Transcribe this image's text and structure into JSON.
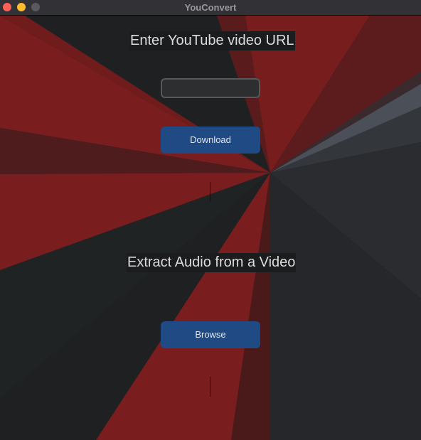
{
  "window": {
    "title": "YouConvert",
    "controls": {
      "close": "#fe5f57",
      "minimize": "#febc2e",
      "zoom": "#5a5a5e"
    }
  },
  "download_section": {
    "heading": "Enter YouTube video URL",
    "url_input": {
      "value": "",
      "placeholder": ""
    },
    "button_label": "Download"
  },
  "extract_section": {
    "heading": "Extract Audio from a Video",
    "button_label": "Browse"
  },
  "colors": {
    "button": "#1f4a84",
    "accent_red": "#7a1d1e",
    "background": "#1e2022"
  }
}
